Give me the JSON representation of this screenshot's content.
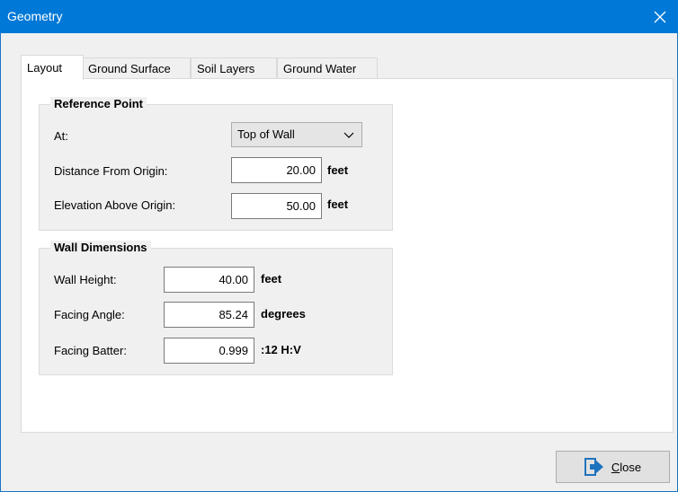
{
  "window": {
    "title": "Geometry"
  },
  "tabs": [
    {
      "label": "Layout",
      "active": true
    },
    {
      "label": "Ground Surface",
      "active": false
    },
    {
      "label": "Soil Layers",
      "active": false
    },
    {
      "label": "Ground Water",
      "active": false
    }
  ],
  "reference_point": {
    "title": "Reference Point",
    "at_label": "At:",
    "at_value": "Top of Wall",
    "distance_label": "Distance From Origin:",
    "distance_value": "20.00",
    "distance_unit": "feet",
    "elevation_label": "Elevation Above Origin:",
    "elevation_value": "50.00",
    "elevation_unit": "feet"
  },
  "wall_dimensions": {
    "title": "Wall Dimensions",
    "height_label": "Wall Height:",
    "height_value": "40.00",
    "height_unit": "feet",
    "angle_label": "Facing Angle:",
    "angle_value": "85.24",
    "angle_unit": "degrees",
    "batter_label": "Facing Batter:",
    "batter_value": "0.999",
    "batter_unit": ":12 H:V"
  },
  "buttons": {
    "close_rest": "lose",
    "close_mnemonic": "C"
  },
  "colors": {
    "titlebar": "#0078d7",
    "dialog_bg": "#f0f0f0",
    "icon_blue": "#1e73be"
  }
}
